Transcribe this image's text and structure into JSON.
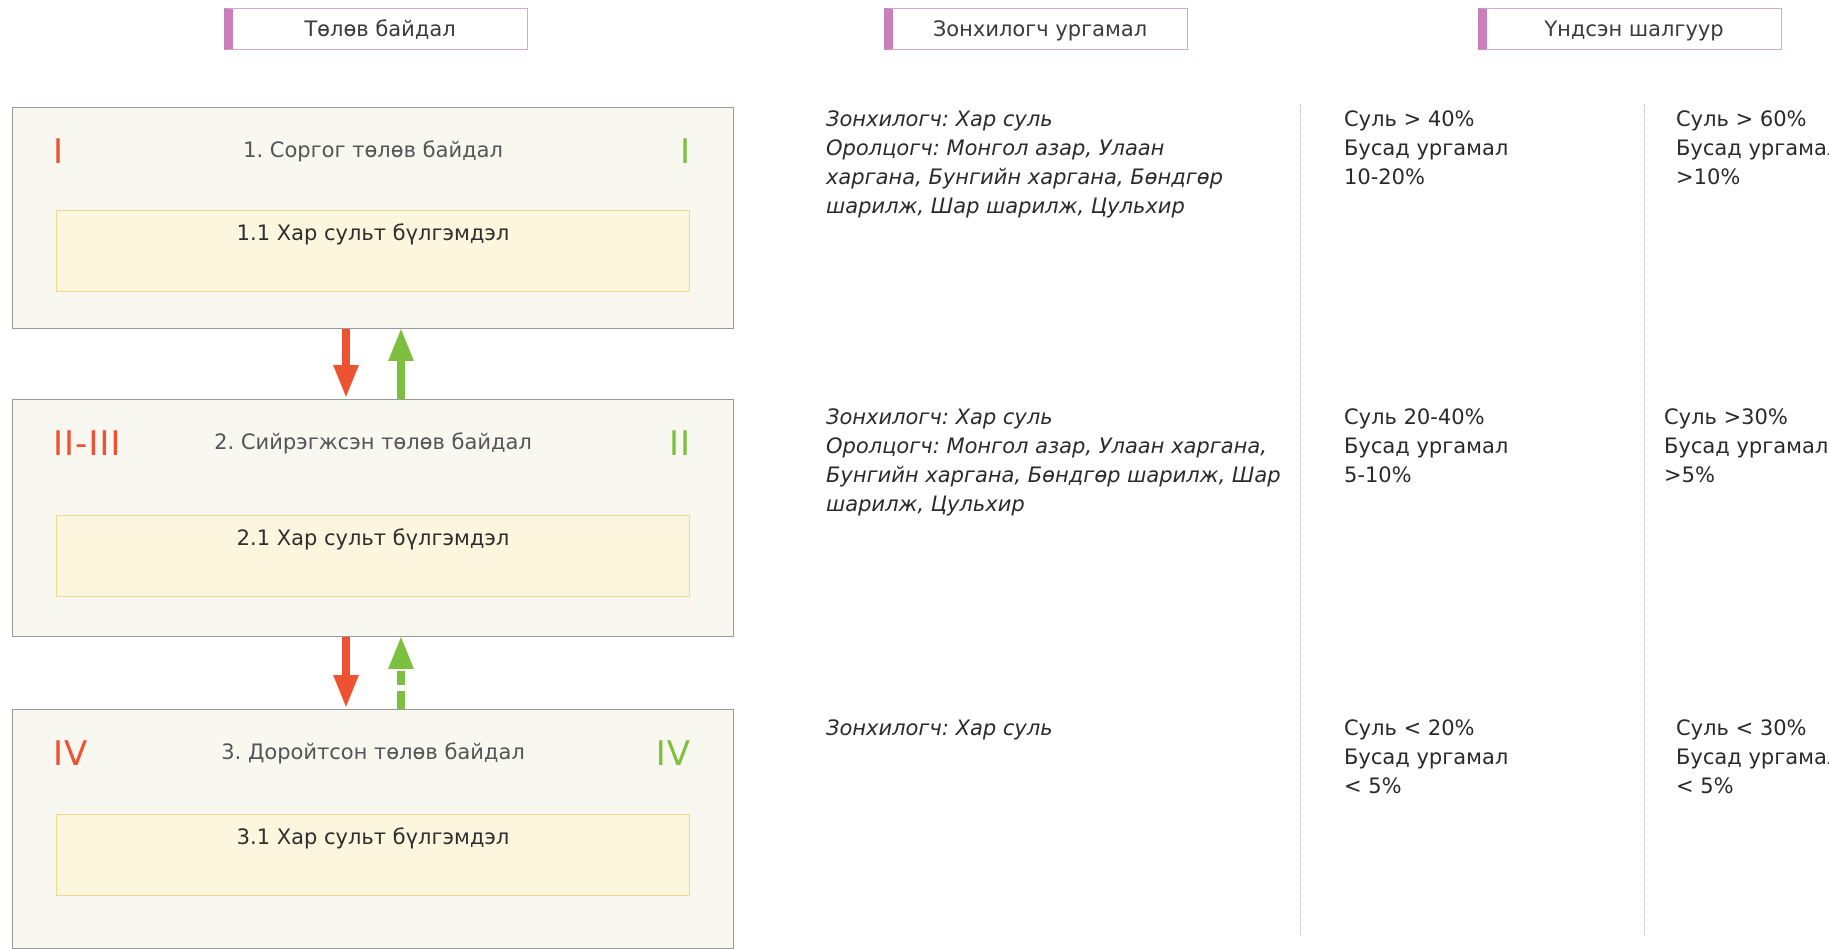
{
  "headers": {
    "state": "Төлөв байдал",
    "plants": "Зонхилогч ургамал",
    "criteria": "Үндсэн шалгуур"
  },
  "colors": {
    "degrade_red": "#ee5230",
    "recover_green": "#7dbf3f",
    "header_accent": "#c97fba"
  },
  "states": [
    {
      "roman_left": "I",
      "title": "1. Соргог төлөв байдал",
      "roman_right": "I",
      "community": "1.1 Хар сульт бүлгэмдэл",
      "plants_lines": [
        "Зонхилогч: Хар суль",
        "Оролцогч: Монгол азар, Улаан",
        "харгана, Бунгийн харгана, Бөндгөр",
        "шарилж, Шар шарилж, Цульхир"
      ],
      "criteria_a": [
        "Суль > 40%",
        "Бусад ургамал",
        "10-20%"
      ],
      "criteria_b": [
        "Суль > 60%",
        "Бусад ургамал",
        ">10%"
      ]
    },
    {
      "roman_left": "II-III",
      "title": "2. Сийрэгжсэн төлөв байдал",
      "roman_right": "II",
      "community": "2.1 Хар сульт бүлгэмдэл",
      "plants_lines": [
        "Зонхилогч: Хар суль",
        "Оролцогч: Монгол азар, Улаан харгана,",
        "Бунгийн харгана, Бөндгөр шарилж, Шар",
        "шарилж, Цульхир"
      ],
      "criteria_a": [
        "Суль 20-40%",
        "Бусад ургамал",
        "5-10%"
      ],
      "criteria_b": [
        "Суль >30%",
        "Бусад ургамал",
        ">5%"
      ]
    },
    {
      "roman_left": "IV",
      "title": "3. Доройтсон төлөв байдал",
      "roman_right": "IV",
      "community": "3.1 Хар сульт бүлгэмдэл",
      "plants_lines": [
        "Зонхилогч: Хар суль"
      ],
      "criteria_a": [
        "Суль < 20%",
        "Бусад ургамал",
        "< 5%"
      ],
      "criteria_b": [
        "Суль < 30%",
        "Бусад ургамал",
        "< 5%"
      ]
    }
  ]
}
